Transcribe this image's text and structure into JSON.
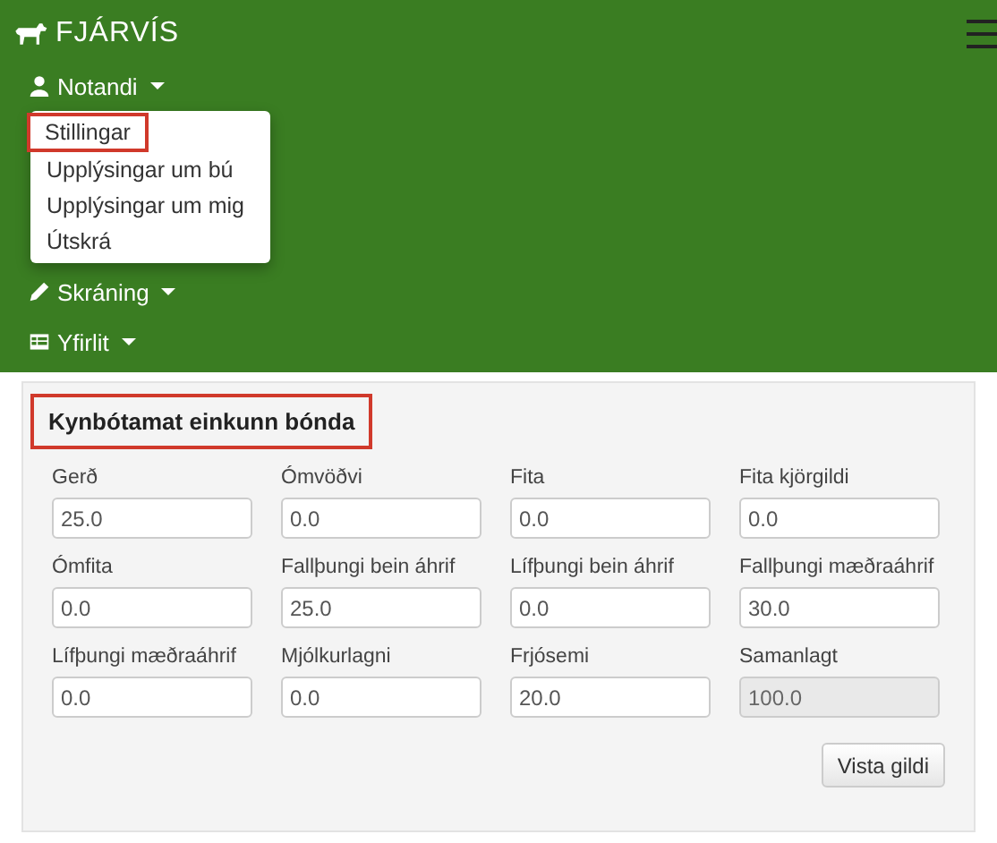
{
  "brand": {
    "name": "FJÁRVÍS"
  },
  "nav": [
    {
      "label": "Notandi",
      "items": [
        {
          "label": "Stillingar",
          "highlighted": true
        },
        {
          "label": "Upplýsingar um bú",
          "highlighted": false
        },
        {
          "label": "Upplýsingar um mig",
          "highlighted": false
        },
        {
          "label": "Útskrá",
          "highlighted": false
        }
      ]
    },
    {
      "label": "Skráning"
    },
    {
      "label": "Yfirlit"
    }
  ],
  "panel": {
    "title": "Kynbótamat einkunn bónda",
    "title_highlighted": true,
    "fields": [
      {
        "label": "Gerð",
        "value": "25.0",
        "disabled": false
      },
      {
        "label": "Ómvöðvi",
        "value": "0.0",
        "disabled": false
      },
      {
        "label": "Fita",
        "value": "0.0",
        "disabled": false
      },
      {
        "label": "Fita kjörgildi",
        "value": "0.0",
        "disabled": false
      },
      {
        "label": "Ómfita",
        "value": "0.0",
        "disabled": false
      },
      {
        "label": "Fallþungi bein áhrif",
        "value": "25.0",
        "disabled": false
      },
      {
        "label": "Lífþungi bein áhrif",
        "value": "0.0",
        "disabled": false
      },
      {
        "label": "Fallþungi mæðraáhrif",
        "value": "30.0",
        "disabled": false
      },
      {
        "label": "Lífþungi mæðraáhrif",
        "value": "0.0",
        "disabled": false
      },
      {
        "label": "Mjólkurlagni",
        "value": "0.0",
        "disabled": false
      },
      {
        "label": "Frjósemi",
        "value": "20.0",
        "disabled": false
      },
      {
        "label": "Samanlagt",
        "value": "100.0",
        "disabled": true
      }
    ],
    "button": "Vista gildi"
  }
}
